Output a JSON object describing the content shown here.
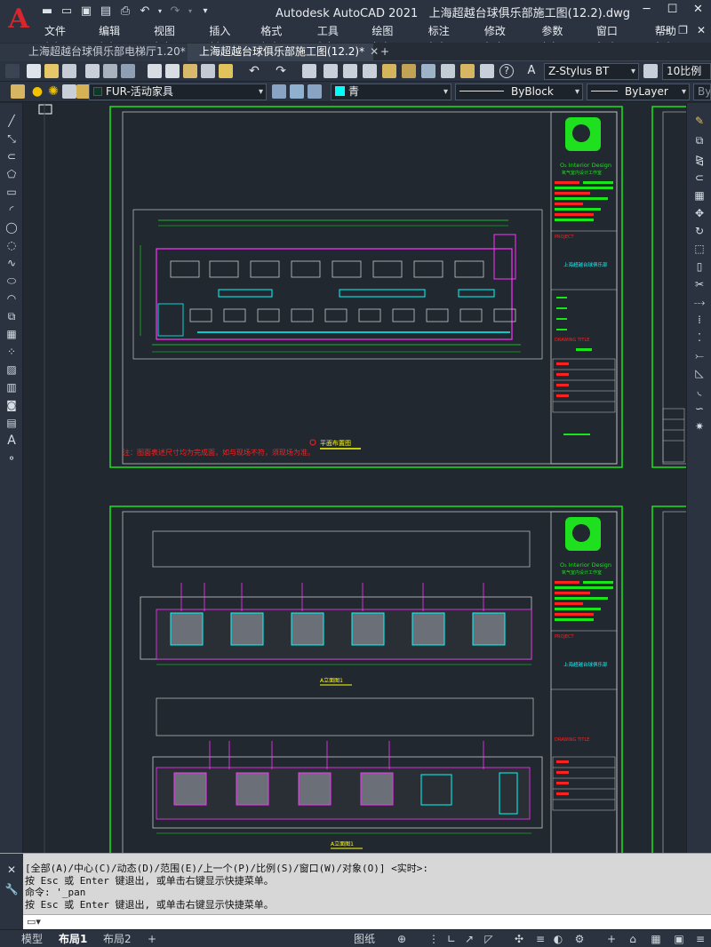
{
  "app": {
    "title": "Autodesk AutoCAD 2021",
    "document": "上海超越台球俱乐部施工图(12.2).dwg",
    "logo_letter": "A"
  },
  "menu": [
    "文件(F)",
    "编辑(E)",
    "视图(V)",
    "插入(I)",
    "格式(O)",
    "工具(T)",
    "绘图(D)",
    "标注(N)",
    "修改(M)",
    "参数(P)",
    "窗口(W)",
    "帮助(H)"
  ],
  "tabs": [
    {
      "label": "上海超越台球俱乐部电梯厅1.20*"
    },
    {
      "label": "上海超越台球俱乐部施工图(12.2)*"
    }
  ],
  "toolbar": {
    "text_style": "Z-Stylus BT",
    "dim_scale": "10比例",
    "layer": "FUR-活动家具",
    "color": "青",
    "linetype": "ByBlock",
    "lineweight": "ByLayer",
    "plotstyle": "By"
  },
  "drawing": {
    "sheet1_note": "注：图面表述尺寸均为完成面，如与现场不符，须现场为准。",
    "sheet1_title": "平面布置图",
    "elevation_a_title": "A立面图1",
    "elevation_b_title": "A立面图1",
    "brand_en": "O₂ Interior Design",
    "brand_cn": "氧气室内设计工作室",
    "project_label": "PROJECT",
    "project_name": "上海超越台球俱乐部",
    "drawing_title_label": "DRAWING TITLE"
  },
  "command": {
    "lines": [
      "[全部(A)/中心(C)/动态(D)/范围(E)/上一个(P)/比例(S)/窗口(W)/对象(O)] <实时>:",
      "按 Esc 或 Enter 键退出, 或单击右键显示快捷菜单。",
      "命令: '_pan",
      "按 Esc 或 Enter 键退出, 或单击右键显示快捷菜单。"
    ]
  },
  "status": {
    "tabs": [
      "模型",
      "布局1",
      "布局2"
    ],
    "active_tab": "布局1",
    "space": "图纸"
  },
  "colors": {
    "sheet_border": "#19e619",
    "accent_red": "#ff2020",
    "cyan": "#00ffff",
    "magenta": "#ff33ff",
    "yellow": "#ffff00"
  }
}
